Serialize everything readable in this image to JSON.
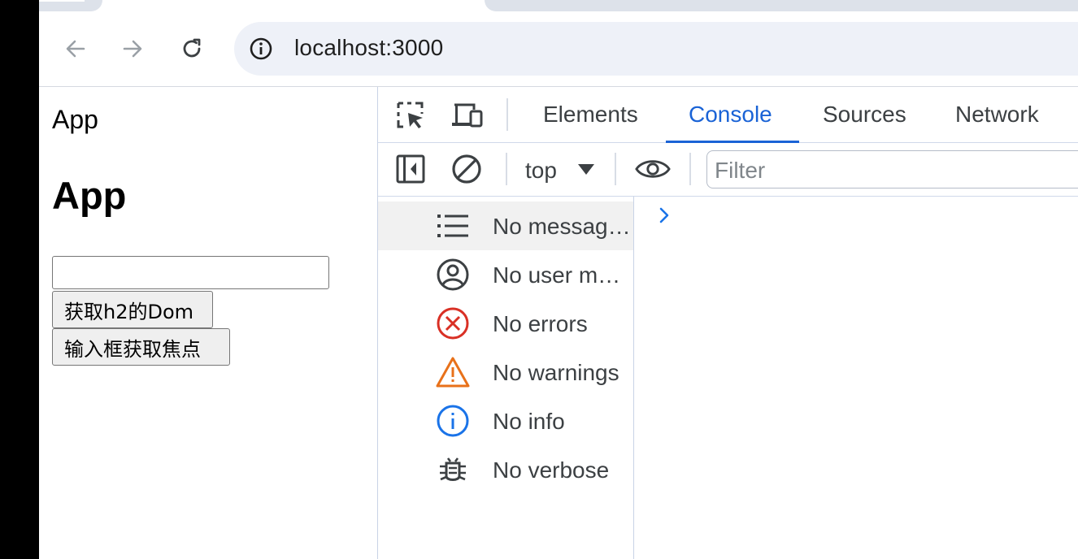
{
  "browser": {
    "url": "localhost:3000",
    "icons": [
      "back-arrow-icon",
      "forward-arrow-icon",
      "reload-icon",
      "site-info-icon"
    ]
  },
  "page": {
    "text": "App",
    "heading": "App",
    "input_value": "",
    "buttons": [
      "获取h2的Dom",
      "输入框获取焦点"
    ]
  },
  "devtools": {
    "tabs": [
      {
        "label": "Elements",
        "active": false
      },
      {
        "label": "Console",
        "active": true
      },
      {
        "label": "Sources",
        "active": false
      },
      {
        "label": "Network",
        "active": false
      }
    ],
    "context": "top",
    "filter_placeholder": "Filter",
    "sidebar": [
      {
        "label": "No messag…",
        "icon": "list-icon",
        "selected": true
      },
      {
        "label": "No user m…",
        "icon": "user-icon",
        "selected": false
      },
      {
        "label": "No errors",
        "icon": "error-icon",
        "selected": false
      },
      {
        "label": "No warnings",
        "icon": "warning-icon",
        "selected": false
      },
      {
        "label": "No info",
        "icon": "info-icon",
        "selected": false
      },
      {
        "label": "No verbose",
        "icon": "bug-icon",
        "selected": false
      }
    ],
    "colors": {
      "accent": "#1a63d6",
      "error": "#d93025",
      "warning": "#e8711a",
      "info": "#1a73e8"
    }
  }
}
